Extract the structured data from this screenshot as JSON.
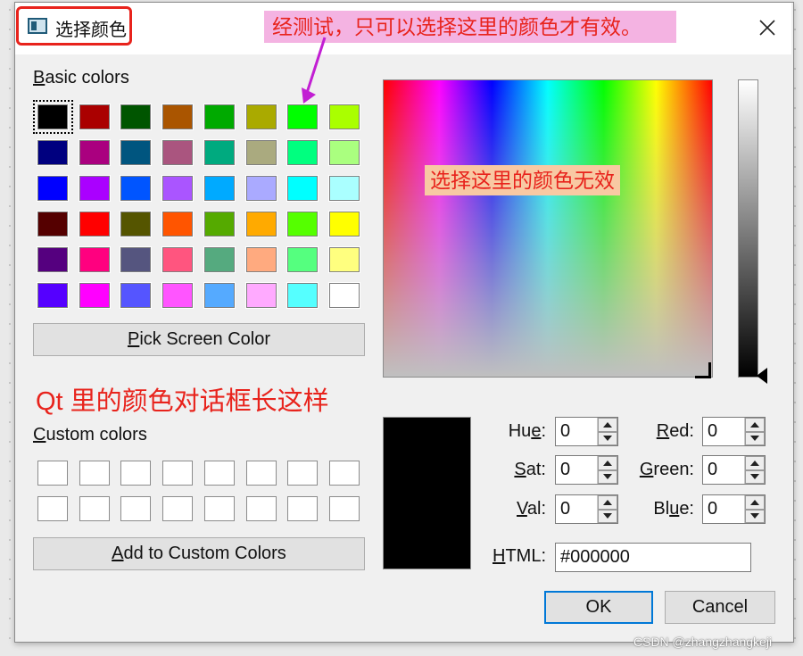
{
  "window": {
    "title": "选择颜色",
    "close_icon": "close-icon"
  },
  "annotations": {
    "top": "经测试，只可以选择这里的颜色才有效。",
    "spectrum": "选择这里的颜色无效",
    "qt": "Qt 里的颜色对话框长这样"
  },
  "basic_colors": {
    "label_mnemonic": "B",
    "label_rest": "asic colors",
    "swatches": [
      [
        "#000000",
        "#aa0000",
        "#005500",
        "#aa5500",
        "#00aa00",
        "#aaaa00",
        "#00ff00",
        "#aaff00"
      ],
      [
        "#00007f",
        "#aa007f",
        "#00557f",
        "#aa557f",
        "#00aa7f",
        "#aaaa7f",
        "#00ff7f",
        "#aaff7f"
      ],
      [
        "#0000ff",
        "#aa00ff",
        "#0055ff",
        "#aa55ff",
        "#00aaff",
        "#aaaaff",
        "#00ffff",
        "#aaffff"
      ],
      [
        "#550000",
        "#ff0000",
        "#555500",
        "#ff5500",
        "#55aa00",
        "#ffaa00",
        "#55ff00",
        "#ffff00"
      ],
      [
        "#55007f",
        "#ff007f",
        "#55557f",
        "#ff557f",
        "#55aa7f",
        "#ffaa7f",
        "#55ff7f",
        "#ffff7f"
      ],
      [
        "#5500ff",
        "#ff00ff",
        "#5555ff",
        "#ff55ff",
        "#55aaff",
        "#ffaaff",
        "#55ffff",
        "#ffffff"
      ]
    ]
  },
  "pick_button": {
    "mnemonic": "P",
    "rest": "ick Screen Color"
  },
  "custom_colors": {
    "label_mnemonic": "C",
    "label_rest": "ustom colors",
    "rows": 2,
    "cols": 8
  },
  "add_button": {
    "mnemonic": "A",
    "rest": "dd to Custom Colors"
  },
  "current_color": "#000000",
  "fields": {
    "hue": {
      "pre": "Hu",
      "mnemonic": "e",
      "post": ":",
      "value": "0"
    },
    "sat": {
      "pre": "",
      "mnemonic": "S",
      "post": "at:",
      "value": "0"
    },
    "val": {
      "pre": "",
      "mnemonic": "V",
      "post": "al:",
      "value": "0"
    },
    "red": {
      "pre": "",
      "mnemonic": "R",
      "post": "ed:",
      "value": "0"
    },
    "green": {
      "pre": "",
      "mnemonic": "G",
      "post": "reen:",
      "value": "0"
    },
    "blue": {
      "pre": "Bl",
      "mnemonic": "u",
      "post": "e:",
      "value": "0"
    },
    "html": {
      "pre": "",
      "mnemonic": "H",
      "post": "TML:",
      "value": "#000000"
    }
  },
  "buttons": {
    "ok": "OK",
    "cancel": "Cancel"
  },
  "watermark": "CSDN @zhangzhangkeji",
  "colors": {
    "annotation_red": "#e8231c",
    "annotation_pink_bg": "#f4b3e2",
    "annotation_peach_bg": "#f8c9a3",
    "arrow_magenta": "#c21fd3",
    "focus_blue": "#0078d7"
  }
}
